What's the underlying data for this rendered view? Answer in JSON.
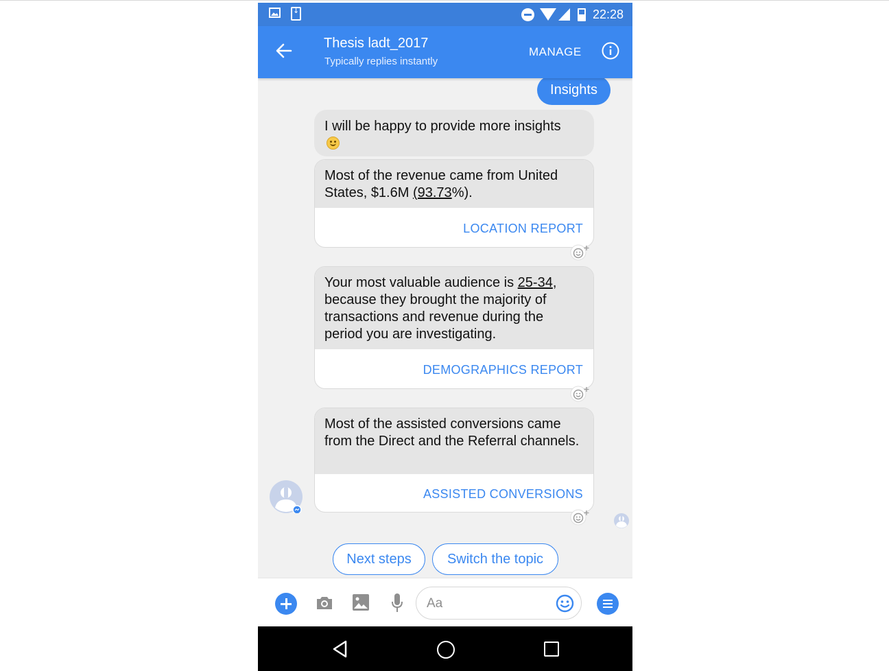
{
  "status_bar": {
    "time": "22:28"
  },
  "header": {
    "title": "Thesis ladt_2017",
    "subtitle": "Typically replies instantly",
    "manage_label": "MANAGE"
  },
  "messages": {
    "user_message": "Insights",
    "bot_intro": "I will be happy to provide more insights",
    "cards": [
      {
        "text_before": "Most of the revenue came from United States, $1.6M ",
        "link_text": "(93.73",
        "text_after": "%).",
        "button_label": "LOCATION REPORT"
      },
      {
        "text_before": "Your most valuable audience is ",
        "link_text": "25-34",
        "text_after": ", because they brought the majority of transactions and revenue during the period you are investigating.",
        "button_label": "DEMOGRAPHICS REPORT"
      },
      {
        "text": "Most of the assisted conversions came from the Direct and the Referral channels.",
        "button_label": "ASSISTED CONVERSIONS"
      }
    ]
  },
  "quick_replies": [
    "Next steps",
    "Switch the topic"
  ],
  "composer": {
    "placeholder": "Aa"
  },
  "colors": {
    "accent": "#3b88f0",
    "status_bar": "#3b7fdb",
    "bubble": "#e5e5e5",
    "nav_bar": "#000000"
  },
  "icons": [
    "back-arrow-icon",
    "info-icon",
    "plus-icon",
    "camera-icon",
    "image-icon",
    "microphone-icon",
    "emoji-icon",
    "menu-icon",
    "reaction-icon",
    "bot-avatar",
    "triangle-back-icon",
    "circle-home-icon",
    "square-recents-icon"
  ]
}
